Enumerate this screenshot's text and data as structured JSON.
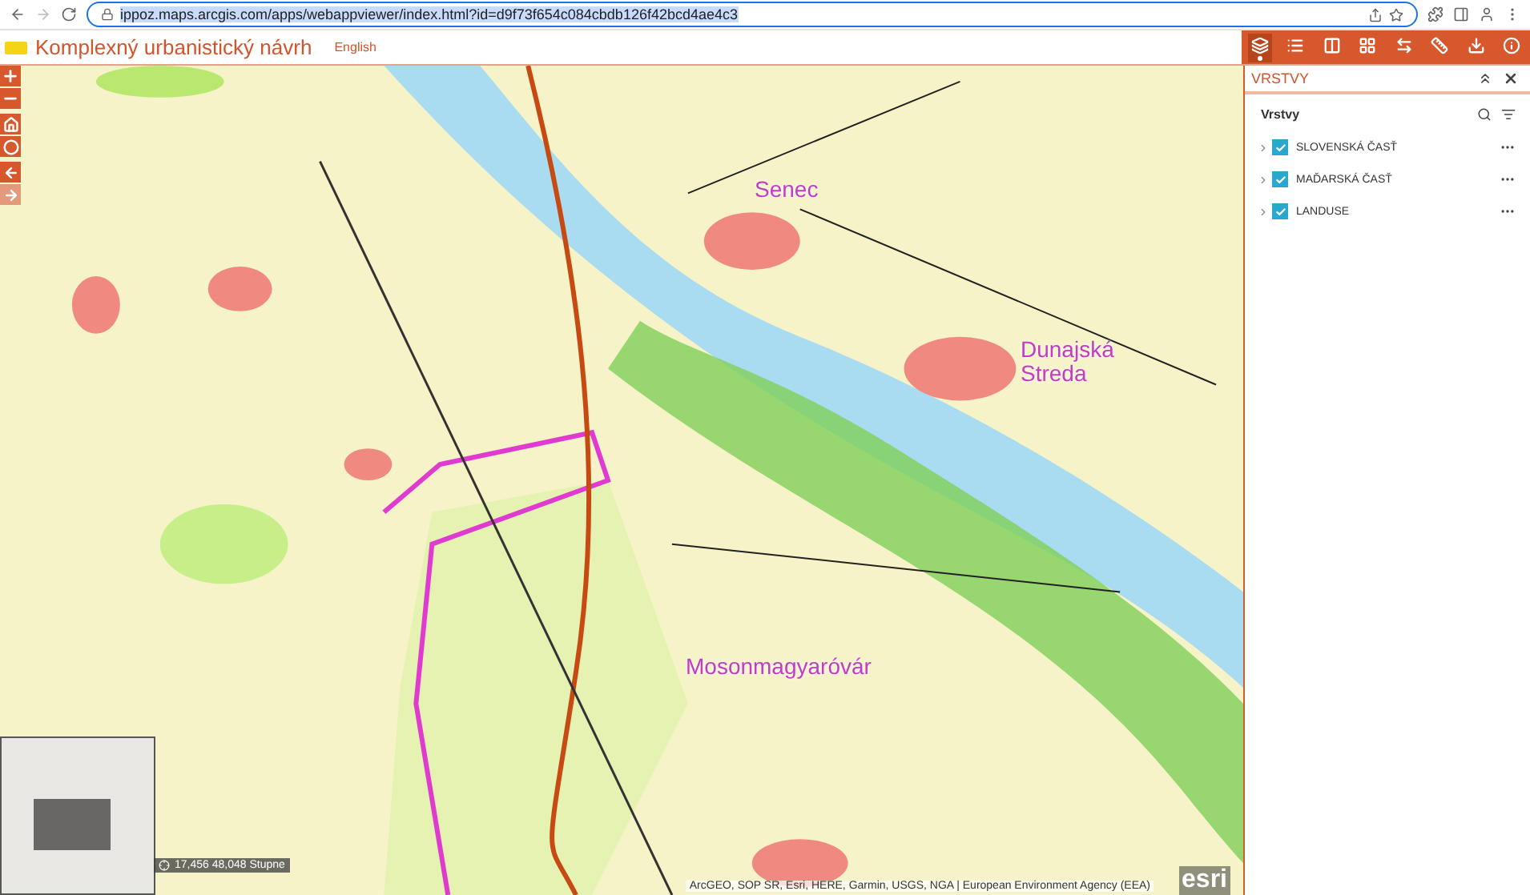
{
  "browser": {
    "url": "ippoz.maps.arcgis.com/apps/webappviewer/index.html?id=d9f73f654c084cbdb126f42bcd4ae4c3"
  },
  "header": {
    "title": "Komplexný urbanistický návrh",
    "language_link": "English"
  },
  "toolbar": [
    {
      "kind": "layers",
      "selected": true
    },
    {
      "kind": "list",
      "selected": false
    },
    {
      "kind": "compare",
      "selected": false
    },
    {
      "kind": "grid",
      "selected": false
    },
    {
      "kind": "swap",
      "selected": false
    },
    {
      "kind": "ruler",
      "selected": false
    },
    {
      "kind": "download",
      "selected": false
    },
    {
      "kind": "info",
      "selected": false
    }
  ],
  "panel": {
    "title": "VRSTVY",
    "heading": "Vrstvy",
    "layers": [
      {
        "name": "SLOVENSKÁ ČASŤ",
        "checked": true
      },
      {
        "name": "MAĎARSKÁ ČASŤ",
        "checked": true
      },
      {
        "name": "LANDUSE",
        "checked": true
      }
    ]
  },
  "map": {
    "labels": [
      {
        "text": "Senec"
      },
      {
        "text": "Dunajská Streda"
      },
      {
        "text": "Mosonmagyaróvár"
      }
    ],
    "coordinates": "17,456 48,048 Stupne",
    "attribution": "ArcGEO, SOP SR, Esri, HERE, Garmin, USGS, NGA | European Environment Agency (EEA)",
    "logo": "esri"
  }
}
